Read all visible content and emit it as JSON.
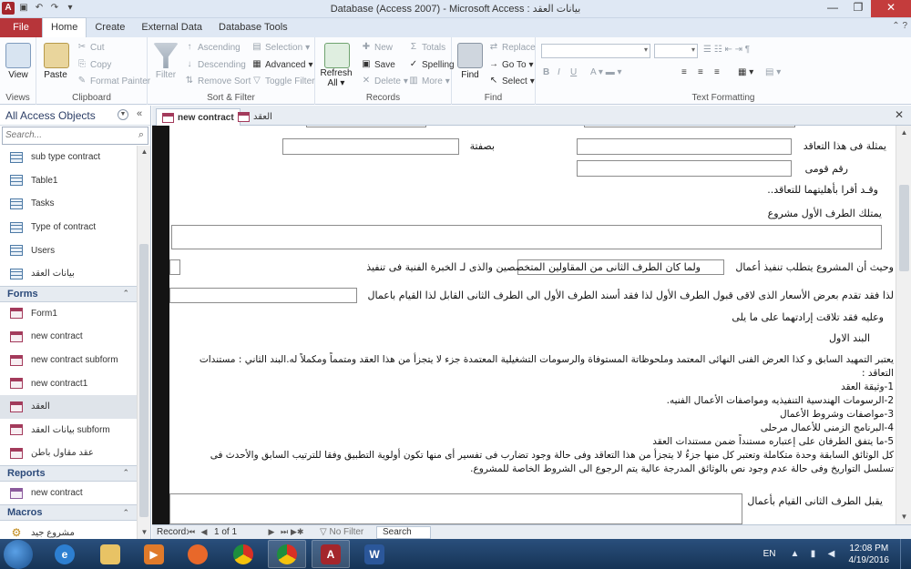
{
  "window": {
    "title": "Database (Access 2007) - Microsoft Access : بيانات العقد",
    "app_icon": "A"
  },
  "ribbon": {
    "tabs": [
      "File",
      "Home",
      "Create",
      "External Data",
      "Database Tools"
    ],
    "active_tab": "Home",
    "groups": {
      "views": {
        "label": "Views",
        "view": "View"
      },
      "clipboard": {
        "label": "Clipboard",
        "paste": "Paste",
        "cut": "Cut",
        "copy": "Copy",
        "format_painter": "Format Painter"
      },
      "sort_filter": {
        "label": "Sort & Filter",
        "filter": "Filter",
        "ascending": "Ascending",
        "descending": "Descending",
        "remove_sort": "Remove Sort",
        "selection": "Selection",
        "advanced": "Advanced",
        "toggle_filter": "Toggle Filter"
      },
      "records": {
        "label": "Records",
        "refresh": "Refresh",
        "refresh_all": "All",
        "new": "New",
        "save": "Save",
        "delete": "Delete",
        "totals": "Totals",
        "spelling": "Spelling",
        "more": "More"
      },
      "find": {
        "label": "Find",
        "find": "Find",
        "replace": "Replace",
        "goto": "Go To",
        "select": "Select"
      },
      "text_formatting": {
        "label": "Text Formatting"
      }
    }
  },
  "nav": {
    "title": "All Access Objects",
    "search_placeholder": "Search...",
    "tables": [
      "sub type contract",
      "Table1",
      "Tasks",
      "Type of contract",
      "Users",
      "بيانات العقد"
    ],
    "forms_label": "Forms",
    "forms": [
      "Form1",
      "new contract",
      "new contract subform",
      "new contract1",
      "العقد",
      "بيانات العقد subform",
      "عقد مقاول باطن"
    ],
    "selected_form": "العقد",
    "reports_label": "Reports",
    "reports": [
      "new contract"
    ],
    "macros_label": "Macros",
    "macros": [
      "مشروع جيد"
    ]
  },
  "doc_tabs": [
    {
      "label": "new contract",
      "active": true
    },
    {
      "label": "العقد",
      "active": false
    }
  ],
  "form": {
    "lbl_represented": "يمثلة فى هذا التعاقد",
    "lbl_capacity": "بصفتة",
    "lbl_national_id": "رقم قومى",
    "lbl_eligibility": "وقـد أقرا بأهليتهما للتعاقد..",
    "lbl_owns_project": "يمتلك الطرف الأول مشروع",
    "lbl_project_requires": "وحيث أن المشروع يتطلب تنفيذ أعمال",
    "lbl_second_party": "ولما كان الطرف الثانى من المقاولين المتخصصين والذى لـ الخبرة الفنية فى تنفيذ",
    "lbl_offer": "لذا فقد تقدم بعرض الأسعار الذى لاقى قبول الطرف الأول لذا فقد أسند الطرف الأول الى الطرف الثانى القابل لذا القيام باعمال",
    "lbl_agreed": "وعليه فقد تلاقت إرادتهما على ما يلى",
    "lbl_clause1": "البند الاول",
    "paragraph": [
      "يعتبر التمهيد السابق و كذا العرض الفنى النهائى المعتمد وملحوظاتة المستوفاة والرسومات التشغيلية المعتمدة جزء لا يتجزأ من هذا العقد ومتمماً ومكملاً له.البند الثاني : مستندات",
      "التعاقد :",
      "1-وثيقة العقد",
      "2-الرسومات الهندسية التنفيذيه ومواصفات الأعمال الفنيه.",
      "3-مواصفات وشروط الأعمال",
      "4-البرنامج الزمنى للأعمال مرحلى",
      "5-ما يتفق الطرفان على إعتباره مستنداً ضمن مستندات العقد",
      "كل الوثائق السابقة وحدة متكاملة وتعتبر كل منها جزءُ لا يتجزأ من هذا التعاقد وفى حالة وجود تضارب فى تفسير أى منها تكون أولوية التطبيق وفقا للترتيب السابق والأحدث فى",
      "تسلسل التواريخ وفى حالة عدم وجود نص بالوثائق المدرجة عالية يتم الرجوع الى الشروط الخاصة للمشروع."
    ],
    "lbl_accepts": "يقبل الطرف الثانى القيام بأعمال"
  },
  "record_nav": {
    "label": "Record:",
    "position": "1 of 1",
    "filter": "No Filter",
    "search": "Search"
  },
  "taskbar": {
    "language": "EN",
    "time": "12:08 PM",
    "date": "4/19/2016"
  }
}
